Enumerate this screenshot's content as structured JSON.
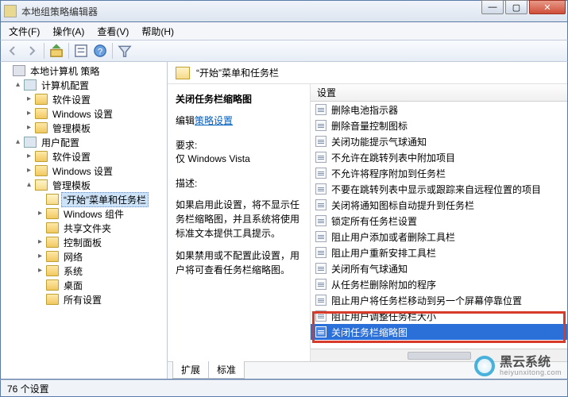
{
  "window": {
    "title": "本地组策略编辑器",
    "min": "—",
    "max": "▢",
    "close": "✕"
  },
  "menu": {
    "file": "文件(F)",
    "action": "操作(A)",
    "view": "查看(V)",
    "help": "帮助(H)"
  },
  "tree": {
    "root": "本地计算机 策略",
    "computer_cfg": "计算机配置",
    "user_cfg": "用户配置",
    "software": "软件设置",
    "windows": "Windows 设置",
    "admin_tpl": "管理模板",
    "start_taskbar": "“开始”菜单和任务栏",
    "win_components": "Windows 组件",
    "shared_folders": "共享文件夹",
    "control_panel": "控制面板",
    "network": "网络",
    "system": "系统",
    "desktop": "桌面",
    "all_settings": "所有设置"
  },
  "content": {
    "header": "“开始”菜单和任务栏",
    "policy_title": "关闭任务栏缩略图",
    "edit_prefix": "编辑",
    "edit_link": "策略设置",
    "req_label": "要求:",
    "req_value": "仅 Windows Vista",
    "desc_label": "描述:",
    "desc_p1": "如果启用此设置，将不显示任务栏缩略图，并且系统将使用标准文本提供工具提示。",
    "desc_p2": "如果禁用或不配置此设置，用户将可查看任务栏缩略图。",
    "list_header": "设置",
    "items": [
      "删除电池指示器",
      "删除音量控制图标",
      "关闭功能提示气球通知",
      "不允许在跳转列表中附加项目",
      "不允许将程序附加到任务栏",
      "不要在跳转列表中显示或跟踪来自远程位置的项目",
      "关闭将通知图标自动提升到任务栏",
      "锁定所有任务栏设置",
      "阻止用户添加或者删除工具栏",
      "阻止用户重新安排工具栏",
      "关闭所有气球通知",
      "从任务栏删除附加的程序",
      "阻止用户将任务栏移动到另一个屏幕停靠位置",
      "阻止用户调整任务栏大小",
      "关闭任务栏缩略图"
    ],
    "selected_index": 14,
    "tabs": {
      "extended": "扩展",
      "standard": "标准"
    }
  },
  "status": "76 个设置",
  "watermark": {
    "cn": "黑云系统",
    "en": "heiyunxitong.com"
  }
}
